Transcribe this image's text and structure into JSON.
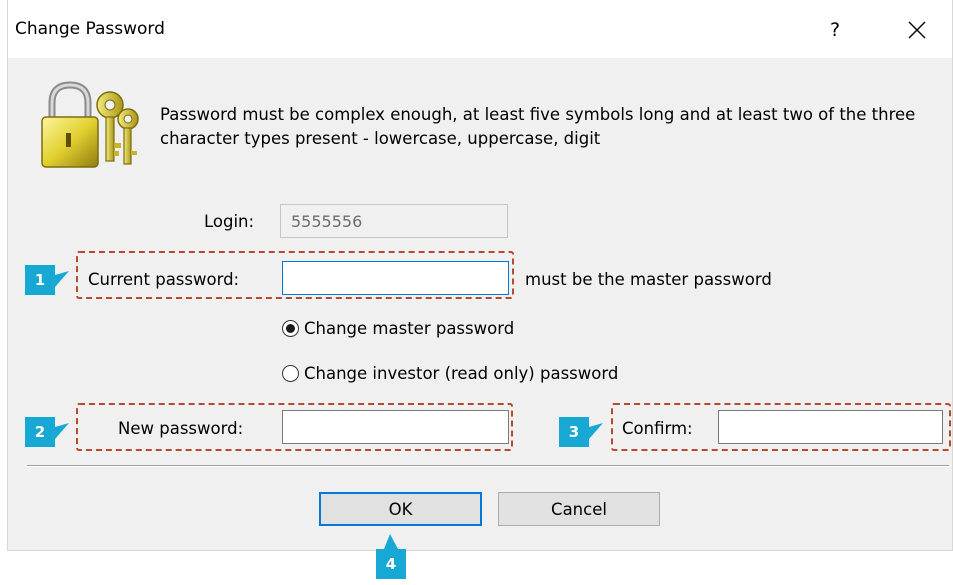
{
  "window": {
    "title": "Change Password",
    "help_label": "?",
    "close_icon": "close-icon"
  },
  "info": {
    "icon": "lock-keys-icon",
    "text": "Password must be complex enough, at least five symbols long and at least two of the three character types present - lowercase, uppercase, digit"
  },
  "login": {
    "label": "Login:",
    "value": "5555556"
  },
  "current_password": {
    "label": "Current password:",
    "value": "",
    "hint": "must be the master password"
  },
  "mode": {
    "options": [
      {
        "label": "Change master password",
        "selected": true
      },
      {
        "label": "Change investor (read only) password",
        "selected": false
      }
    ]
  },
  "new_password": {
    "label": "New password:",
    "value": ""
  },
  "confirm": {
    "label": "Confirm:",
    "value": ""
  },
  "buttons": {
    "ok": "OK",
    "cancel": "Cancel"
  },
  "annotations": {
    "marker1": "1",
    "marker2": "2",
    "marker3": "3",
    "marker4": "4",
    "color": "#17a9d4",
    "outline_color": "#b64a2f"
  }
}
